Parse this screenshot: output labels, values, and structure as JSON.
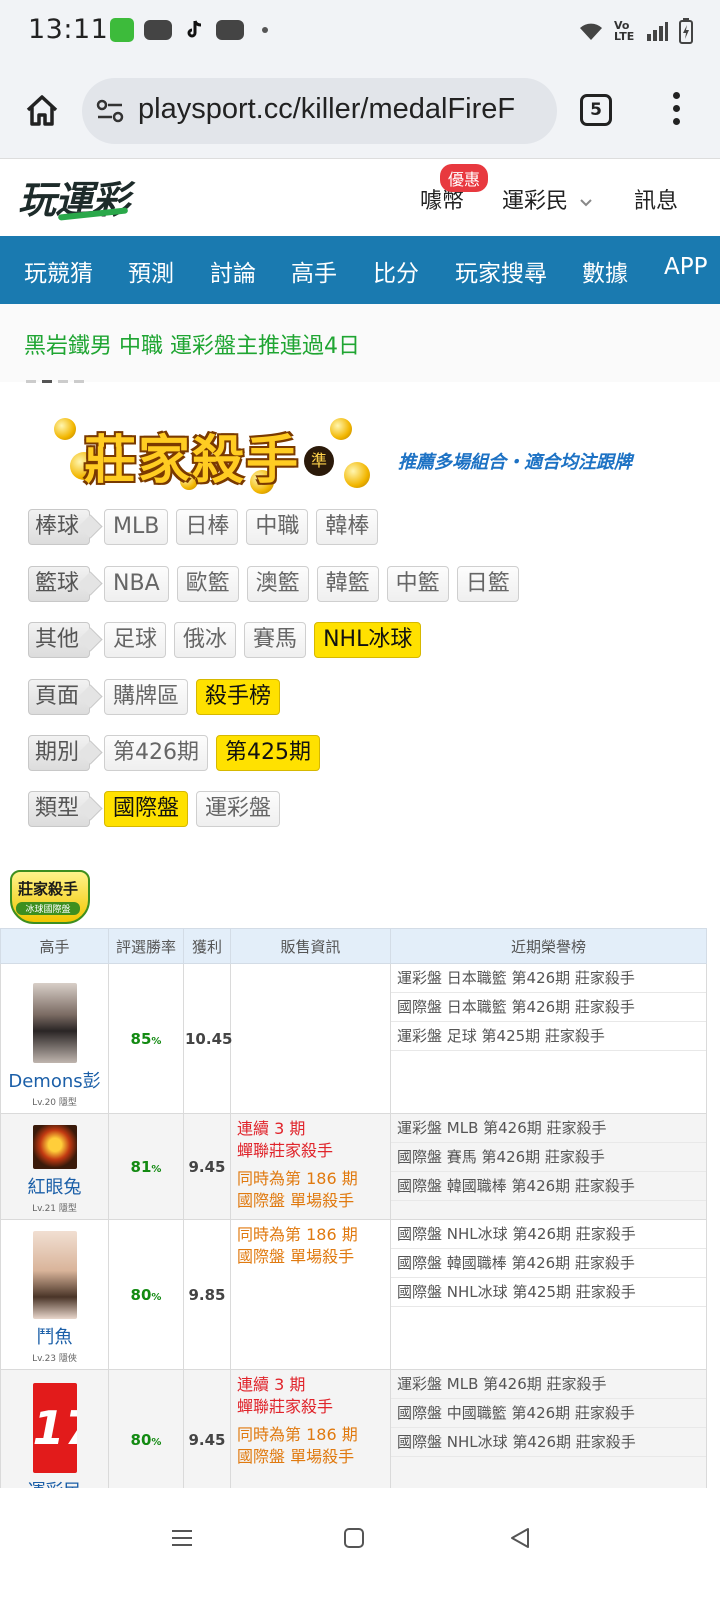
{
  "status": {
    "time": "13:11",
    "icons": [
      "wechat-icon",
      "youtube-icon",
      "tiktok-icon",
      "youtube-icon",
      "dot-icon"
    ],
    "right_icons": [
      "wifi-icon",
      "volte-icon",
      "signal-icon",
      "battery-icon"
    ],
    "volte_label": "Vo LTE"
  },
  "browser": {
    "url": "playsport.cc/killer/medalFireF",
    "tab_count": "5"
  },
  "header": {
    "logo": "玩運彩",
    "promo_badge": "優惠",
    "coin_link": "噱幣",
    "member_link": "運彩民",
    "message_link": "訊息"
  },
  "nav": [
    "玩競猜",
    "預測",
    "討論",
    "高手",
    "比分",
    "玩家搜尋",
    "數據",
    "APP"
  ],
  "ticker": "黑岩鐵男  中職 運彩盤主推連過4日",
  "banner": {
    "title": "莊家殺手",
    "badge": "準",
    "subtitle": "推薦多場組合・適合均注跟牌"
  },
  "filters": [
    {
      "label": "棒球",
      "options": [
        {
          "text": "MLB",
          "selected": false
        },
        {
          "text": "日棒",
          "selected": false
        },
        {
          "text": "中職",
          "selected": false
        },
        {
          "text": "韓棒",
          "selected": false
        }
      ]
    },
    {
      "label": "籃球",
      "options": [
        {
          "text": "NBA",
          "selected": false
        },
        {
          "text": "歐籃",
          "selected": false
        },
        {
          "text": "澳籃",
          "selected": false
        },
        {
          "text": "韓籃",
          "selected": false
        },
        {
          "text": "中籃",
          "selected": false
        },
        {
          "text": "日籃",
          "selected": false
        }
      ]
    },
    {
      "label": "其他",
      "options": [
        {
          "text": "足球",
          "selected": false
        },
        {
          "text": "俄冰",
          "selected": false
        },
        {
          "text": "賽馬",
          "selected": false
        },
        {
          "text": "NHL冰球",
          "selected": true
        }
      ]
    },
    {
      "label": "頁面",
      "options": [
        {
          "text": "購牌區",
          "selected": false
        },
        {
          "text": "殺手榜",
          "selected": true
        }
      ]
    },
    {
      "label": "期別",
      "options": [
        {
          "text": "第426期",
          "selected": false
        },
        {
          "text": "第425期",
          "selected": true
        }
      ]
    },
    {
      "label": "類型",
      "options": [
        {
          "text": "國際盤",
          "selected": true
        },
        {
          "text": "運彩盤",
          "selected": false
        }
      ]
    }
  ],
  "medal": {
    "title": "莊家殺手",
    "subtitle": "冰球國際盤"
  },
  "table": {
    "headers": [
      "高手",
      "評選勝率",
      "獲利",
      "販售資訊",
      "近期榮譽榜"
    ],
    "rows": [
      {
        "name": "Demons彭",
        "level": "Lv.20 隱型",
        "rate": "85",
        "rate_unit": "%",
        "profit": "10.45",
        "sale": [],
        "honors": [
          "運彩盤 日本職籃 第426期 莊家殺手",
          "國際盤 日本職籃 第426期 莊家殺手",
          "運彩盤 足球 第425期 莊家殺手"
        ]
      },
      {
        "name": "紅眼兔",
        "level": "Lv.21 隱型",
        "rate": "81",
        "rate_unit": "%",
        "profit": "9.45",
        "sale": [
          {
            "color": "red",
            "line1": "連續 3 期",
            "line2": "蟬聯莊家殺手"
          },
          {
            "color": "orange",
            "line1": "同時為第 186 期",
            "line2": "國際盤 單場殺手"
          }
        ],
        "honors": [
          "運彩盤 MLB 第426期 莊家殺手",
          "國際盤 賽馬 第426期 莊家殺手",
          "國際盤 韓國職棒 第426期 莊家殺手"
        ]
      },
      {
        "name": "鬥魚",
        "level": "Lv.23 隱俠",
        "rate": "80",
        "rate_unit": "%",
        "profit": "9.85",
        "sale": [
          {
            "color": "orange",
            "line1": "同時為第 186 期",
            "line2": "國際盤 單場殺手"
          }
        ],
        "honors": [
          "國際盤 NHL冰球 第426期 莊家殺手",
          "國際盤 韓國職棒 第426期 莊家殺手",
          "國際盤 NHL冰球 第425期 莊家殺手"
        ]
      },
      {
        "name": "運彩民",
        "level": "",
        "rate": "80",
        "rate_unit": "%",
        "profit": "9.45",
        "sale": [
          {
            "color": "red",
            "line1": "連續 3 期",
            "line2": "蟬聯莊家殺手"
          },
          {
            "color": "orange",
            "line1": "同時為第 186 期",
            "line2": "國際盤 單場殺手"
          }
        ],
        "honors": [
          "運彩盤 MLB 第426期 莊家殺手",
          "國際盤 中國職籃 第426期 莊家殺手",
          "國際盤 NHL冰球 第426期 莊家殺手"
        ]
      }
    ]
  },
  "system_nav": [
    "recents-icon",
    "home-icon",
    "back-icon"
  ]
}
